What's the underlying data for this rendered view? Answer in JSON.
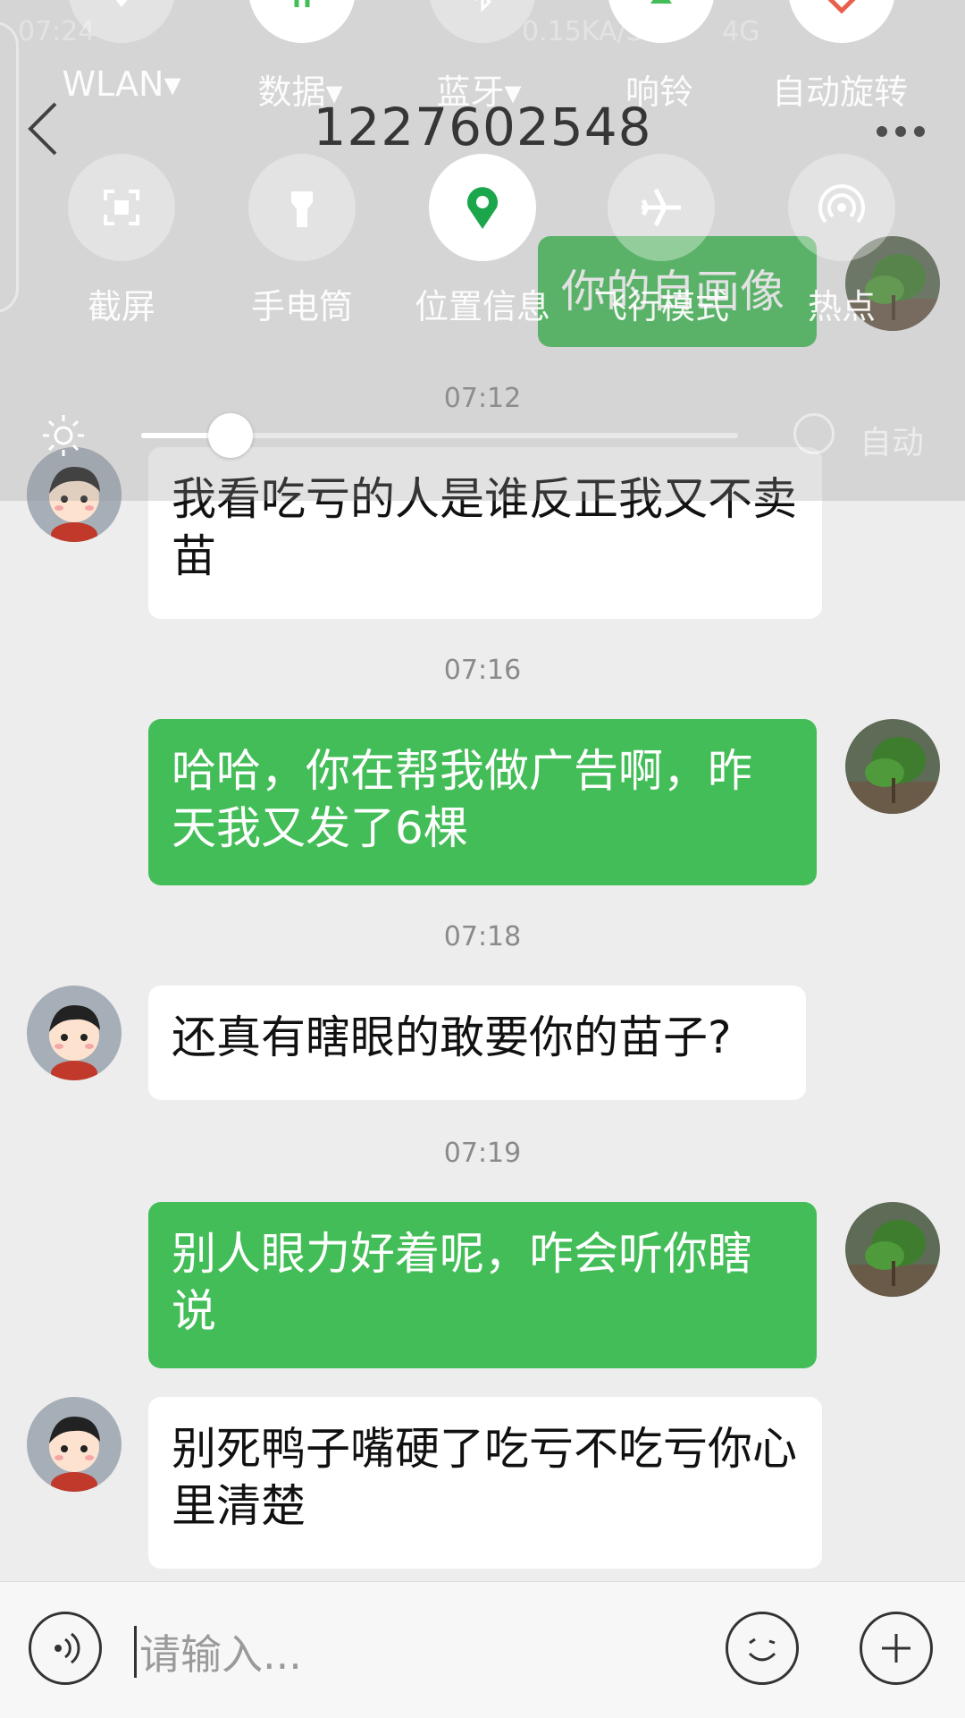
{
  "header": {
    "title": "1227602548"
  },
  "messages": [
    {
      "side": "me",
      "text": "你的自画像"
    },
    {
      "time": "07:12",
      "side": "other",
      "text": "我看吃亏的人是谁反正我又不卖苗"
    },
    {
      "time": "07:16",
      "side": "me",
      "text": "哈哈，你在帮我做广告啊，昨天我又发了6棵"
    },
    {
      "time": "07:18",
      "side": "other",
      "text": "还真有瞎眼的敢要你的苗子?"
    },
    {
      "time": "07:19",
      "side": "me",
      "text": "别人眼力好着呢，咋会听你瞎说"
    },
    {
      "side": "other",
      "text": "别死鸭子嘴硬了吃亏不吃亏你心里清楚"
    }
  ],
  "quick_settings": {
    "status_time": "07:24",
    "status_speed": "0.15KA/S",
    "status_network": "4G",
    "row1": [
      {
        "label": "WLAN",
        "dropdown": true,
        "icon": "wifi-icon"
      },
      {
        "label": "数据",
        "dropdown": true,
        "icon": "data-icon"
      },
      {
        "label": "蓝牙",
        "dropdown": true,
        "icon": "bluetooth-icon"
      },
      {
        "label": "响铃",
        "dropdown": false,
        "icon": "bell-icon"
      },
      {
        "label": "自动旋转",
        "dropdown": false,
        "icon": "rotate-icon"
      }
    ],
    "row2": [
      {
        "label": "截屏",
        "icon": "screenshot-icon",
        "active": false
      },
      {
        "label": "手电筒",
        "icon": "flashlight-icon",
        "active": false
      },
      {
        "label": "位置信息",
        "icon": "location-icon",
        "active": true
      },
      {
        "label": "飞行模式",
        "icon": "airplane-icon",
        "active": false
      },
      {
        "label": "热点",
        "icon": "hotspot-icon",
        "active": false
      }
    ],
    "brightness_level": 0.15,
    "brightness_auto_label": "自动"
  },
  "input": {
    "placeholder": "请输入..."
  },
  "colors": {
    "me_bubble": "#43bd57",
    "other_bubble": "#ffffff",
    "background": "#ededed"
  }
}
